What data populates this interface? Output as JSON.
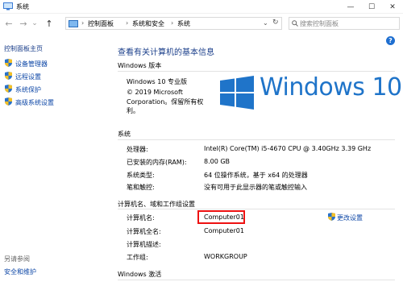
{
  "window": {
    "title": "系统",
    "controls": {
      "minimize": "—",
      "maximize": "☐",
      "close": "✕"
    }
  },
  "nav": {
    "back": "←",
    "forward": "→",
    "history": "⌄",
    "up": "↑",
    "breadcrumb": [
      "控制面板",
      "系统和安全",
      "系统"
    ],
    "separator": "›",
    "search_placeholder": "搜索控制面板"
  },
  "sidebar": {
    "home": "控制面板主页",
    "items": [
      {
        "label": "设备管理器",
        "icon": "shield-icon"
      },
      {
        "label": "远程设置",
        "icon": "shield-icon"
      },
      {
        "label": "系统保护",
        "icon": "shield-icon"
      },
      {
        "label": "高级系统设置",
        "icon": "shield-icon"
      }
    ],
    "see_also_title": "另请参阅",
    "see_also": [
      "安全和维护"
    ]
  },
  "main": {
    "help": "?",
    "heading": "查看有关计算机的基本信息",
    "edition": {
      "title": "Windows 版本",
      "name": "Windows 10 专业版",
      "copyright": "© 2019 Microsoft Corporation。保留所有权利。",
      "copyright_line1": "© 2019 Microsoft",
      "copyright_line2": "Corporation。保留所有权",
      "copyright_line3": "利。",
      "logo_text": "Windows 10",
      "logo_color": "#1f74c9"
    },
    "system": {
      "title": "系统",
      "rows": [
        {
          "label": "处理器:",
          "value": "Intel(R) Core(TM) i5-4670 CPU @ 3.40GHz   3.39 GHz"
        },
        {
          "label": "已安装的内存(RAM):",
          "value": "8.00 GB"
        },
        {
          "label": "系统类型:",
          "value": "64 位操作系统，基于 x64 的处理器"
        },
        {
          "label": "笔和触控:",
          "value": "没有可用于此显示器的笔或触控输入"
        }
      ]
    },
    "computer": {
      "title": "计算机名、域和工作组设置",
      "change_settings": "更改设置",
      "rows": [
        {
          "label": "计算机名:",
          "value": "Computer01"
        },
        {
          "label": "计算机全名:",
          "value": "Computer01"
        },
        {
          "label": "计算机描述:",
          "value": ""
        },
        {
          "label": "工作组:",
          "value": "WORKGROUP"
        }
      ],
      "highlight_color": "#e11111"
    },
    "activation": {
      "title": "Windows 激活"
    }
  }
}
